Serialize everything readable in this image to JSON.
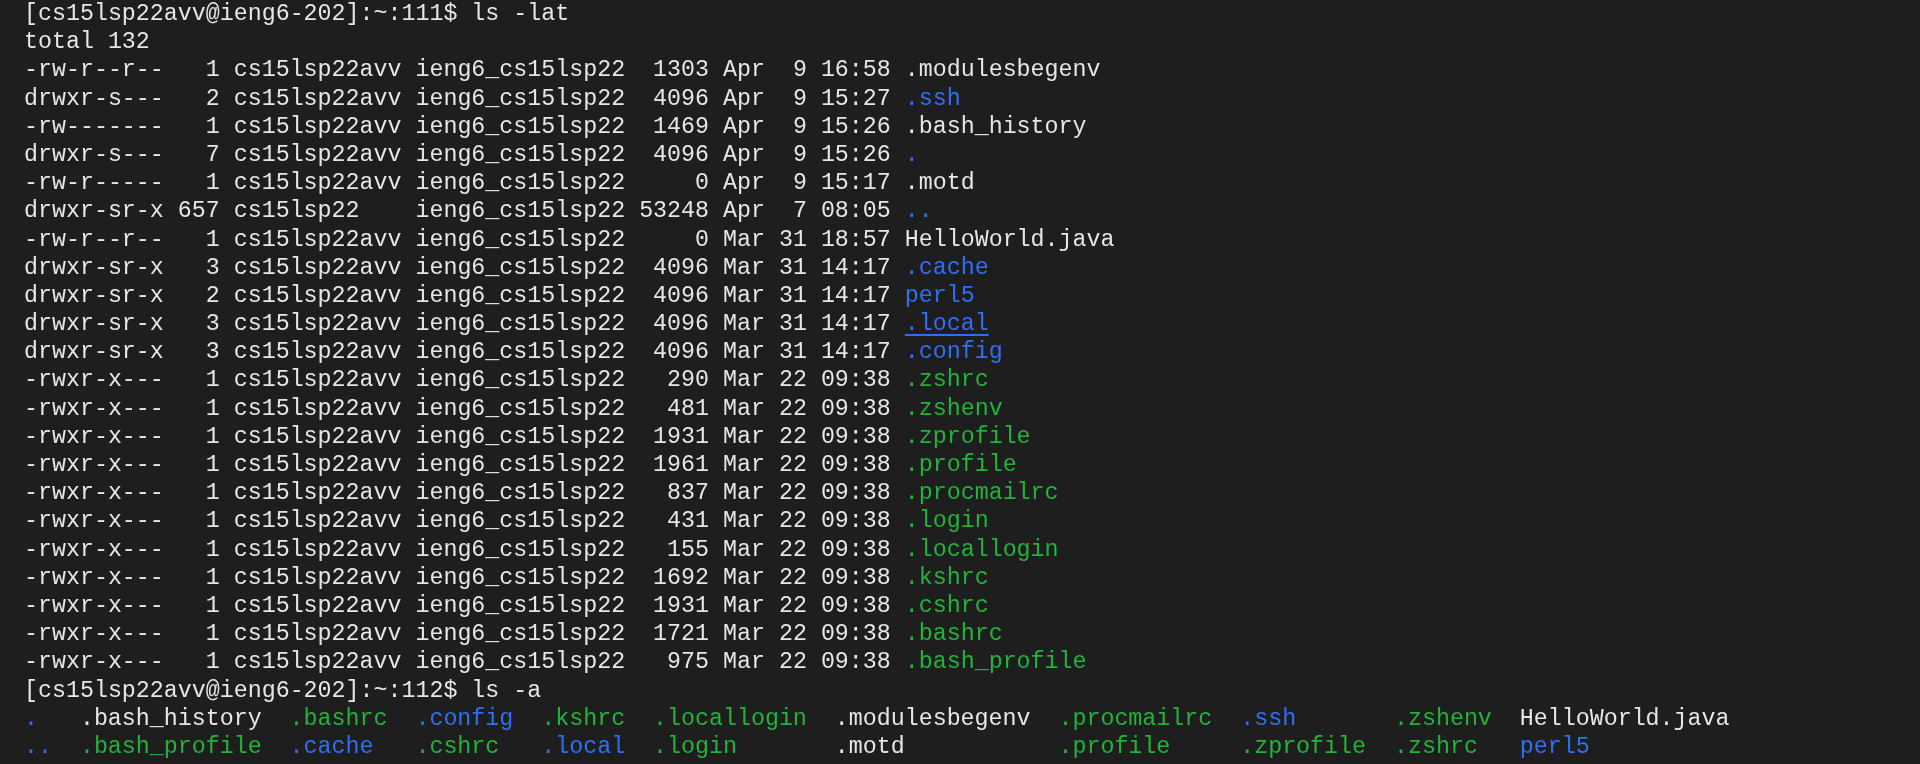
{
  "lines": [
    {
      "kind": "prompt",
      "text": "[cs15lsp22avv@ieng6-202]:~:111$ ls -lat"
    },
    {
      "kind": "plain",
      "text": "total 132"
    },
    {
      "kind": "entry",
      "info": "-rw-r--r--   1 cs15lsp22avv ieng6_cs15lsp22  1303 Apr  9 16:58",
      "name": {
        "text": ".modulesbegenv",
        "kind": "file"
      },
      "underlined": false
    },
    {
      "kind": "entry",
      "info": "drwxr-s---   2 cs15lsp22avv ieng6_cs15lsp22  4096 Apr  9 15:27",
      "name": {
        "text": ".ssh",
        "kind": "dir"
      },
      "underlined": false
    },
    {
      "kind": "entry",
      "info": "-rw-------   1 cs15lsp22avv ieng6_cs15lsp22  1469 Apr  9 15:26",
      "name": {
        "text": ".bash_history",
        "kind": "file"
      },
      "underlined": false
    },
    {
      "kind": "entry",
      "info": "drwxr-s---   7 cs15lsp22avv ieng6_cs15lsp22  4096 Apr  9 15:26",
      "name": {
        "text": ".",
        "kind": "dir"
      },
      "underlined": false
    },
    {
      "kind": "entry",
      "info": "-rw-r-----   1 cs15lsp22avv ieng6_cs15lsp22     0 Apr  9 15:17",
      "name": {
        "text": ".motd",
        "kind": "file"
      },
      "underlined": false
    },
    {
      "kind": "entry",
      "info": "drwxr-sr-x 657 cs15lsp22    ieng6_cs15lsp22 53248 Apr  7 08:05",
      "name": {
        "text": "..",
        "kind": "dir"
      },
      "underlined": false
    },
    {
      "kind": "entry",
      "info": "-rw-r--r--   1 cs15lsp22avv ieng6_cs15lsp22     0 Mar 31 18:57",
      "name": {
        "text": "HelloWorld.java",
        "kind": "file"
      },
      "underlined": false
    },
    {
      "kind": "entry",
      "info": "drwxr-sr-x   3 cs15lsp22avv ieng6_cs15lsp22  4096 Mar 31 14:17",
      "name": {
        "text": ".cache",
        "kind": "dir"
      },
      "underlined": false
    },
    {
      "kind": "entry",
      "info": "drwxr-sr-x   2 cs15lsp22avv ieng6_cs15lsp22  4096 Mar 31 14:17",
      "name": {
        "text": "perl5",
        "kind": "dir"
      },
      "underlined": false
    },
    {
      "kind": "entry",
      "info": "drwxr-sr-x   3 cs15lsp22avv ieng6_cs15lsp22  4096 Mar 31 14:17",
      "name": {
        "text": ".local",
        "kind": "dir"
      },
      "underlined": true
    },
    {
      "kind": "entry",
      "info": "drwxr-sr-x   3 cs15lsp22avv ieng6_cs15lsp22  4096 Mar 31 14:17",
      "name": {
        "text": ".config",
        "kind": "dir"
      },
      "underlined": false
    },
    {
      "kind": "entry",
      "info": "-rwxr-x---   1 cs15lsp22avv ieng6_cs15lsp22   290 Mar 22 09:38",
      "name": {
        "text": ".zshrc",
        "kind": "exec"
      },
      "underlined": false
    },
    {
      "kind": "entry",
      "info": "-rwxr-x---   1 cs15lsp22avv ieng6_cs15lsp22   481 Mar 22 09:38",
      "name": {
        "text": ".zshenv",
        "kind": "exec"
      },
      "underlined": false
    },
    {
      "kind": "entry",
      "info": "-rwxr-x---   1 cs15lsp22avv ieng6_cs15lsp22  1931 Mar 22 09:38",
      "name": {
        "text": ".zprofile",
        "kind": "exec"
      },
      "underlined": false
    },
    {
      "kind": "entry",
      "info": "-rwxr-x---   1 cs15lsp22avv ieng6_cs15lsp22  1961 Mar 22 09:38",
      "name": {
        "text": ".profile",
        "kind": "exec"
      },
      "underlined": false
    },
    {
      "kind": "entry",
      "info": "-rwxr-x---   1 cs15lsp22avv ieng6_cs15lsp22   837 Mar 22 09:38",
      "name": {
        "text": ".procmailrc",
        "kind": "exec"
      },
      "underlined": false
    },
    {
      "kind": "entry",
      "info": "-rwxr-x---   1 cs15lsp22avv ieng6_cs15lsp22   431 Mar 22 09:38",
      "name": {
        "text": ".login",
        "kind": "exec"
      },
      "underlined": false
    },
    {
      "kind": "entry",
      "info": "-rwxr-x---   1 cs15lsp22avv ieng6_cs15lsp22   155 Mar 22 09:38",
      "name": {
        "text": ".locallogin",
        "kind": "exec"
      },
      "underlined": false
    },
    {
      "kind": "entry",
      "info": "-rwxr-x---   1 cs15lsp22avv ieng6_cs15lsp22  1692 Mar 22 09:38",
      "name": {
        "text": ".kshrc",
        "kind": "exec"
      },
      "underlined": false
    },
    {
      "kind": "entry",
      "info": "-rwxr-x---   1 cs15lsp22avv ieng6_cs15lsp22  1931 Mar 22 09:38",
      "name": {
        "text": ".cshrc",
        "kind": "exec"
      },
      "underlined": false
    },
    {
      "kind": "entry",
      "info": "-rwxr-x---   1 cs15lsp22avv ieng6_cs15lsp22  1721 Mar 22 09:38",
      "name": {
        "text": ".bashrc",
        "kind": "exec"
      },
      "underlined": false
    },
    {
      "kind": "entry",
      "info": "-rwxr-x---   1 cs15lsp22avv ieng6_cs15lsp22   975 Mar 22 09:38",
      "name": {
        "text": ".bash_profile",
        "kind": "exec"
      },
      "underlined": false
    },
    {
      "kind": "prompt",
      "text": "[cs15lsp22avv@ieng6-202]:~:112$ ls -a"
    },
    {
      "kind": "grid",
      "columns": [
        [
          {
            "text": ".",
            "kind": "dir"
          },
          {
            "text": "..",
            "kind": "dir"
          }
        ],
        [
          {
            "text": ".bash_history",
            "kind": "file"
          },
          {
            "text": ".bash_profile",
            "kind": "exec"
          }
        ],
        [
          {
            "text": ".bashrc",
            "kind": "exec"
          },
          {
            "text": ".cache",
            "kind": "dir"
          }
        ],
        [
          {
            "text": ".config",
            "kind": "dir"
          },
          {
            "text": ".cshrc",
            "kind": "exec"
          }
        ],
        [
          {
            "text": ".kshrc",
            "kind": "exec"
          },
          {
            "text": ".local",
            "kind": "dir"
          }
        ],
        [
          {
            "text": ".locallogin",
            "kind": "exec"
          },
          {
            "text": ".login",
            "kind": "exec"
          }
        ],
        [
          {
            "text": ".modulesbegenv",
            "kind": "file"
          },
          {
            "text": ".motd",
            "kind": "file"
          }
        ],
        [
          {
            "text": ".procmailrc",
            "kind": "exec"
          },
          {
            "text": ".profile",
            "kind": "exec"
          }
        ],
        [
          {
            "text": ".ssh",
            "kind": "dir"
          },
          {
            "text": ".zprofile",
            "kind": "exec"
          }
        ],
        [
          {
            "text": ".zshenv",
            "kind": "exec"
          },
          {
            "text": ".zshrc",
            "kind": "exec"
          }
        ],
        [
          {
            "text": "HelloWorld.java",
            "kind": "file"
          },
          {
            "text": "perl5",
            "kind": "dir"
          }
        ]
      ]
    }
  ]
}
